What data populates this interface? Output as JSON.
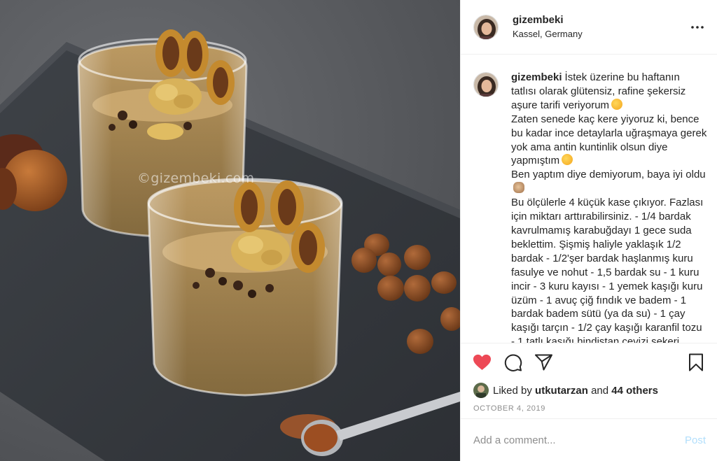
{
  "post": {
    "author": {
      "username": "gizembeki",
      "location": "Kassel, Germany"
    },
    "photo": {
      "watermark": "©gizembeki.com"
    },
    "caption": {
      "username": "gizembeki",
      "paragraphs": [
        "İstek üzerine bu haftanın tatlısı olarak glütensiz, rafine şekersiz aşure tarifi veriyorum",
        "Zaten senede kaç kere yiyoruz ki, bence bu kadar ince detaylarla uğraşmaya gerek yok ama antin kuntinlik olsun diye yapmıştım",
        "Ben yaptım diye demiyorum, baya iyi oldu",
        "Bu ölçülerle 4 küçük kase çıkıyor. Fazlası için miktarı arttırabilirsiniz. - 1/4 bardak kavrulmamış karabuğdayı 1 gece suda beklettim. Şişmiş haliyle yaklaşık 1/2 bardak - 1/2'şer bardak haşlanmış kuru fasulye ve nohut - 1,5 bardak su - 1 kuru incir - 3 kuru kayısı - 1 yemek kaşığı kuru üzüm - 1 avuç çiğ fındık ve badem - 1 bardak badem sütü (ya da su) - 1 çay kaşığı tarçın - 1/2 çay kaşığı karanfil tozu - 1 tatlı kaşığı hindistan cevizi şekeri"
      ]
    },
    "likes": {
      "prefix": "Liked by",
      "user": "utkutarzan",
      "and": "and",
      "others": "44 others"
    },
    "date": "OCTOBER 4, 2019",
    "comment_box": {
      "placeholder": "Add a comment...",
      "post_label": "Post"
    },
    "icons": {
      "like": "heart-filled-icon",
      "comment": "comment-bubble-icon",
      "share": "paper-plane-icon",
      "save": "bookmark-icon",
      "more": "more-options-icon"
    },
    "colors": {
      "like_red": "#ed4956",
      "post_button_disabled": "#b2dffc",
      "muted_text": "#8e8e8e"
    }
  }
}
